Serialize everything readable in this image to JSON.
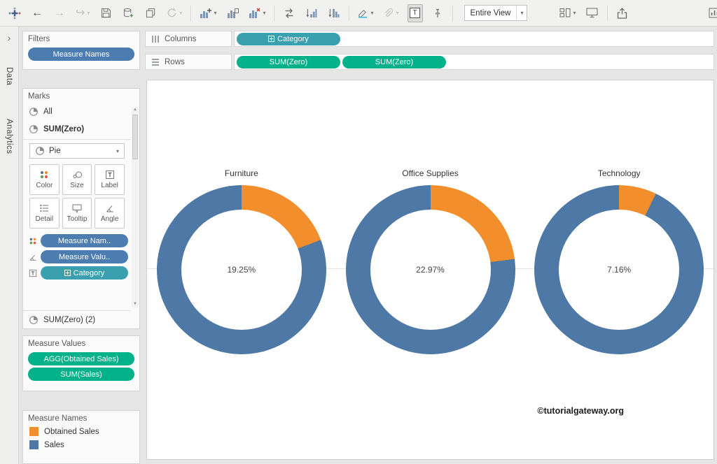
{
  "ui_colors": {
    "dimension_pill_blue": "#4d7cb0",
    "category_pill_teal": "#3a9fae",
    "measure_pill_green": "#00b189"
  },
  "toolbar": {
    "fit_value": "Entire View",
    "glyphs": {
      "undo": "←",
      "redo": "→",
      "replay": "↪",
      "caret": "▾",
      "label_T": "T",
      "scroll_up": "▲",
      "scroll_down": "▼",
      "expand_chevron": "›"
    }
  },
  "side_tabs": {
    "data": "Data",
    "analytics": "Analytics"
  },
  "filters_card": {
    "title": "Filters",
    "pill": "Measure Names"
  },
  "marks_card": {
    "title": "Marks",
    "row_all": "All",
    "row_sum_zero": "SUM(Zero)",
    "mark_type": "Pie",
    "buttons": {
      "color": "Color",
      "size": "Size",
      "label": "Label",
      "detail": "Detail",
      "tooltip": "Tooltip",
      "angle": "Angle"
    },
    "pills": {
      "color": "Measure Nam..",
      "angle": "Measure Valu..",
      "label": "Category"
    },
    "footer": "SUM(Zero) (2)"
  },
  "measure_values_card": {
    "title": "Measure Values",
    "pills": [
      "AGG(Obtained Sales)",
      "SUM(Sales)"
    ]
  },
  "legend_card": {
    "title": "Measure Names",
    "items": [
      {
        "label": "Obtained Sales"
      },
      {
        "label": "Sales"
      }
    ]
  },
  "shelves": {
    "columns_label": "Columns",
    "rows_label": "Rows",
    "columns_pill": "Category",
    "rows_pills": [
      "SUM(Zero)",
      "SUM(Zero)"
    ]
  },
  "chart_data": {
    "type": "pie",
    "subtype": "donut",
    "categories": [
      "Furniture",
      "Office Supplies",
      "Technology"
    ],
    "series": [
      {
        "name": "Obtained Sales",
        "values_pct": [
          19.25,
          22.97,
          7.16
        ]
      },
      {
        "name": "Sales",
        "values_pct": [
          80.75,
          77.03,
          92.84
        ]
      }
    ],
    "charts": [
      {
        "category": "Furniture",
        "obtained_pct": 19.25,
        "label": "19.25%"
      },
      {
        "category": "Office Supplies",
        "obtained_pct": 22.97,
        "label": "22.97%"
      },
      {
        "category": "Technology",
        "obtained_pct": 7.16,
        "label": "7.16%"
      }
    ],
    "colors": {
      "obtained_sales": "#f28e2b",
      "sales": "#4e79a7"
    },
    "legend_position": "bottom-left-card",
    "watermark": "©tutorialgateway.org"
  }
}
